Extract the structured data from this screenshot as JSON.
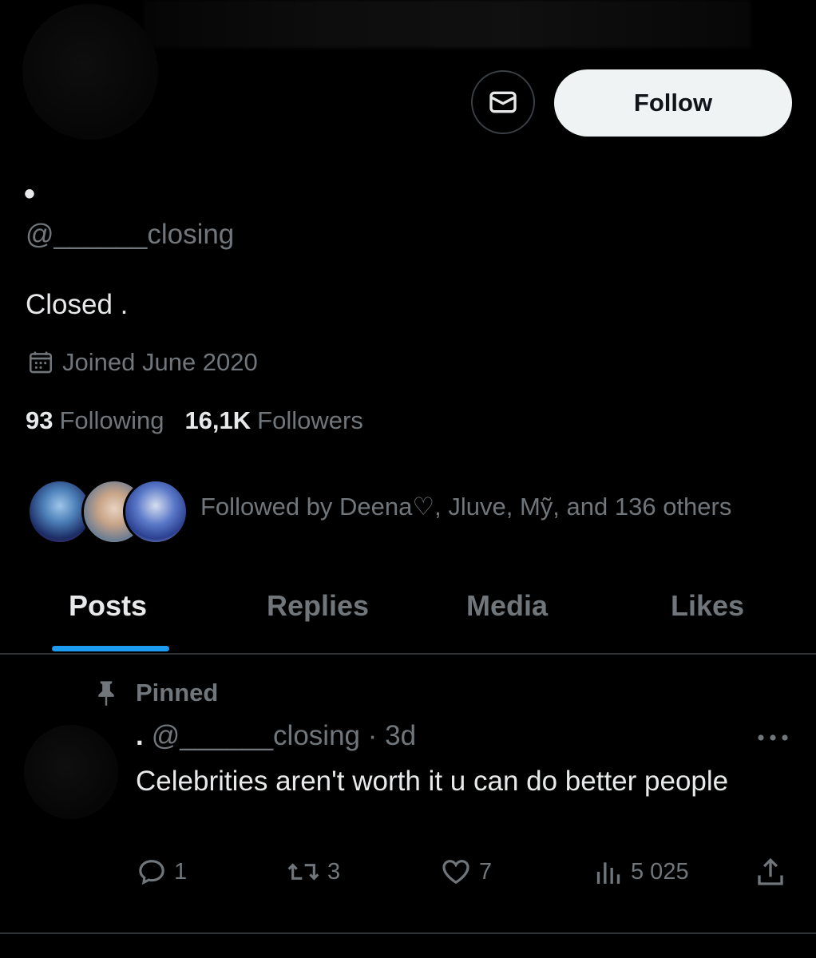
{
  "profile": {
    "display_name": "•",
    "handle": "@______closing",
    "bio": "Closed .",
    "joined": "Joined June 2020",
    "following_count": "93",
    "following_label": "Following",
    "followers_count": "16,1K",
    "followers_label": "Followers",
    "followed_by": "Followed by Deena♡, Jluve, Mỹ, and 136 others"
  },
  "actions": {
    "follow_label": "Follow"
  },
  "tabs": [
    {
      "label": "Posts",
      "active": true
    },
    {
      "label": "Replies",
      "active": false
    },
    {
      "label": "Media",
      "active": false
    },
    {
      "label": "Likes",
      "active": false
    }
  ],
  "pinned_post": {
    "pinned_label": "Pinned",
    "author_name": ".",
    "author_handle": "@______closing",
    "time": "· 3d",
    "text": "Celebrities aren't worth it u can do better people",
    "replies": "1",
    "reposts": "3",
    "likes": "7",
    "views": "5 025"
  },
  "icons": {
    "dm": "envelope-icon",
    "calendar": "calendar-icon",
    "pin": "pin-icon",
    "more": "more-horizontal-icon",
    "reply": "reply-icon",
    "repost": "repost-icon",
    "like": "heart-icon",
    "views": "analytics-icon",
    "share": "share-icon"
  },
  "colors": {
    "background": "#000000",
    "text_primary": "#e7e9ea",
    "text_secondary": "#71767b",
    "accent": "#1d9bf0",
    "follow_button_bg": "#eff3f4",
    "divider": "#2f3336"
  }
}
